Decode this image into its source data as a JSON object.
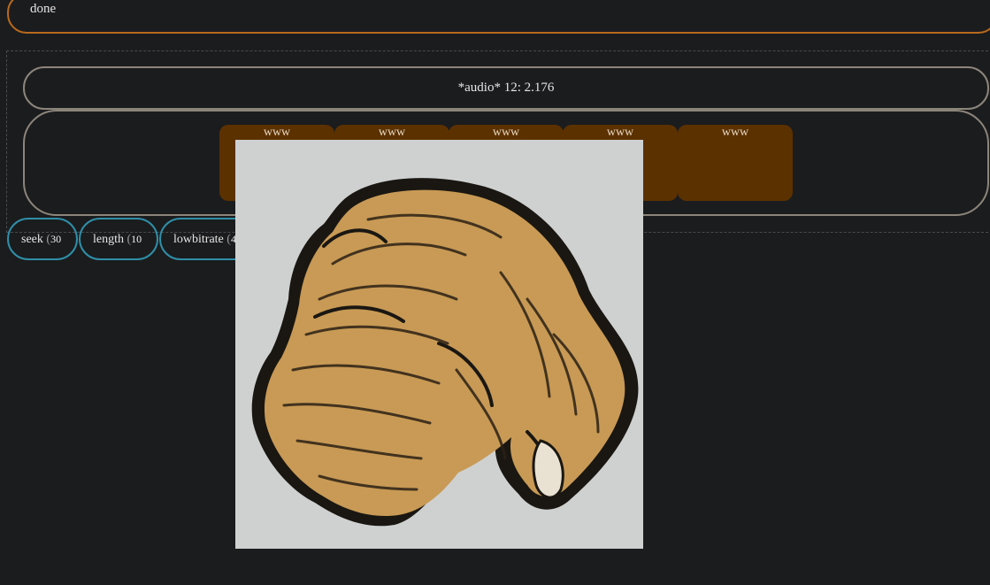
{
  "status": {
    "text": "done"
  },
  "info": {
    "text": "*audio* 12: 2.176"
  },
  "cards": [
    {
      "label": "www"
    },
    {
      "label": "www"
    },
    {
      "label": "www"
    },
    {
      "label": "www"
    },
    {
      "label": "www"
    }
  ],
  "controls": [
    {
      "label": "seek",
      "paren": "(",
      "value": "30"
    },
    {
      "label": "length",
      "paren": "(",
      "value": "10"
    },
    {
      "label": "lowbitrate",
      "paren": "(",
      "value": "4"
    }
  ],
  "overlay": {
    "image": "pointing-hand-illustration"
  },
  "colors": {
    "background": "#1b1c1e",
    "status_border": "#b86a1c",
    "info_border": "#8c857a",
    "card_fill": "#5c3100",
    "control_border": "#2f8fa8"
  }
}
